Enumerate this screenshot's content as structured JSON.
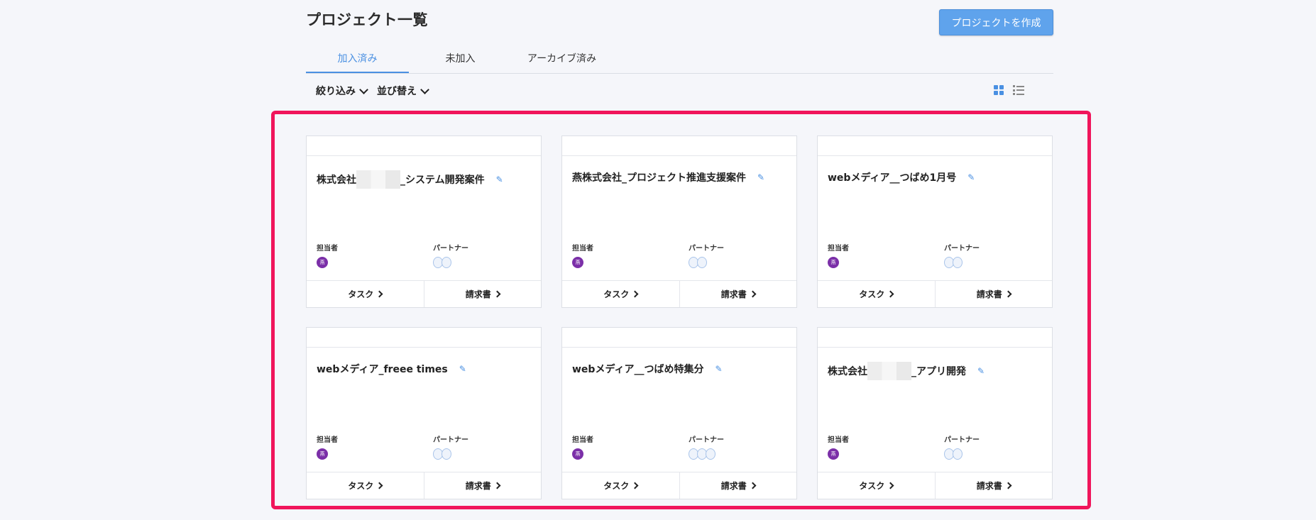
{
  "page": {
    "title": "プロジェクト一覧",
    "create_button": "プロジェクトを作成"
  },
  "tabs": [
    {
      "label": "加入済み",
      "active": true
    },
    {
      "label": "未加入",
      "active": false
    },
    {
      "label": "アーカイブ済み",
      "active": false
    }
  ],
  "filters": {
    "filter_label": "絞り込み",
    "sort_label": "並び替え"
  },
  "colors": {
    "accent": "#4a90e2",
    "highlight": "#f0155b",
    "assignee_avatar": "#7b2fa8"
  },
  "card_labels": {
    "assignee": "担当者",
    "partner": "パートナー",
    "task": "タスク",
    "invoice": "請求書",
    "avatar_char": "燕"
  },
  "projects": [
    {
      "name_prefix": "株式会社",
      "name_suffix": "_システム開発案件",
      "partners": 2
    },
    {
      "name_prefix": "燕株式会社_プロジェクト推進支援案件",
      "name_suffix": "",
      "partners": 2
    },
    {
      "name_prefix": "webメディア__つばめ1月号",
      "name_suffix": "",
      "partners": 2
    },
    {
      "name_prefix": "webメディア_freee times",
      "name_suffix": "",
      "partners": 2
    },
    {
      "name_prefix": "webメディア__つばめ特集分",
      "name_suffix": "",
      "partners": 3
    },
    {
      "name_prefix": "株式会社",
      "name_suffix": "_アプリ開発",
      "partners": 2
    }
  ]
}
